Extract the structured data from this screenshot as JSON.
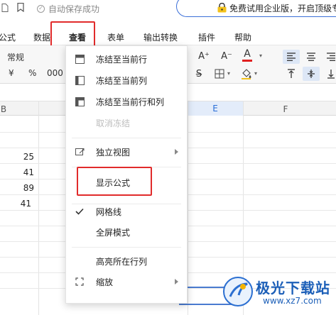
{
  "topbar": {
    "save_status": "自动保存成功",
    "promo_text": "免费试用企业版，开启顶级专"
  },
  "menubar": {
    "tabs": [
      {
        "label": "公式"
      },
      {
        "label": "数据"
      },
      {
        "label": "查看"
      },
      {
        "label": "表单"
      },
      {
        "label": "输出转换"
      },
      {
        "label": "插件"
      },
      {
        "label": "帮助"
      }
    ],
    "active_tab": "查看"
  },
  "toolbar": {
    "number_format": "常规",
    "currency_symbol": "¥",
    "percent_symbol": "%",
    "thousands_symbol": "000",
    "increase_font": "A⁺",
    "decrease_font": "A⁻",
    "font_color_glyph": "A",
    "font_color": "#e02020",
    "strikethrough_glyph": "S"
  },
  "sheet": {
    "columns": [
      "B",
      "E",
      "F"
    ],
    "active_column": "E",
    "cells": [
      "25",
      "41",
      "89",
      "41"
    ]
  },
  "view_menu": {
    "items": [
      {
        "label": "冻结至当前行",
        "icon": "freeze-row-icon",
        "enabled": true
      },
      {
        "label": "冻结至当前列",
        "icon": "freeze-column-icon",
        "enabled": true
      },
      {
        "label": "冻结至当前行和列",
        "icon": "freeze-row-column-icon",
        "enabled": true
      },
      {
        "label": "取消冻结",
        "icon": "",
        "enabled": false
      },
      {
        "label": "独立视图",
        "icon": "independent-view-icon",
        "enabled": true,
        "submenu": true
      },
      {
        "label": "显示公式",
        "icon": "",
        "enabled": true,
        "highlighted": true
      },
      {
        "label": "网格线",
        "icon": "checkmark-icon",
        "enabled": true,
        "checked": true
      },
      {
        "label": "全屏模式",
        "icon": "",
        "enabled": true
      },
      {
        "label": "高亮所在行列",
        "icon": "",
        "enabled": true
      },
      {
        "label": "缩放",
        "icon": "zoom-expand-icon",
        "enabled": true,
        "submenu": true
      }
    ]
  },
  "watermark": {
    "title": "极光下载站",
    "url": "www.xz7.com"
  },
  "colors": {
    "highlight_red": "#e12b2b",
    "accent_blue": "#2a6ed6",
    "selection_blue": "#4a7bd0"
  }
}
